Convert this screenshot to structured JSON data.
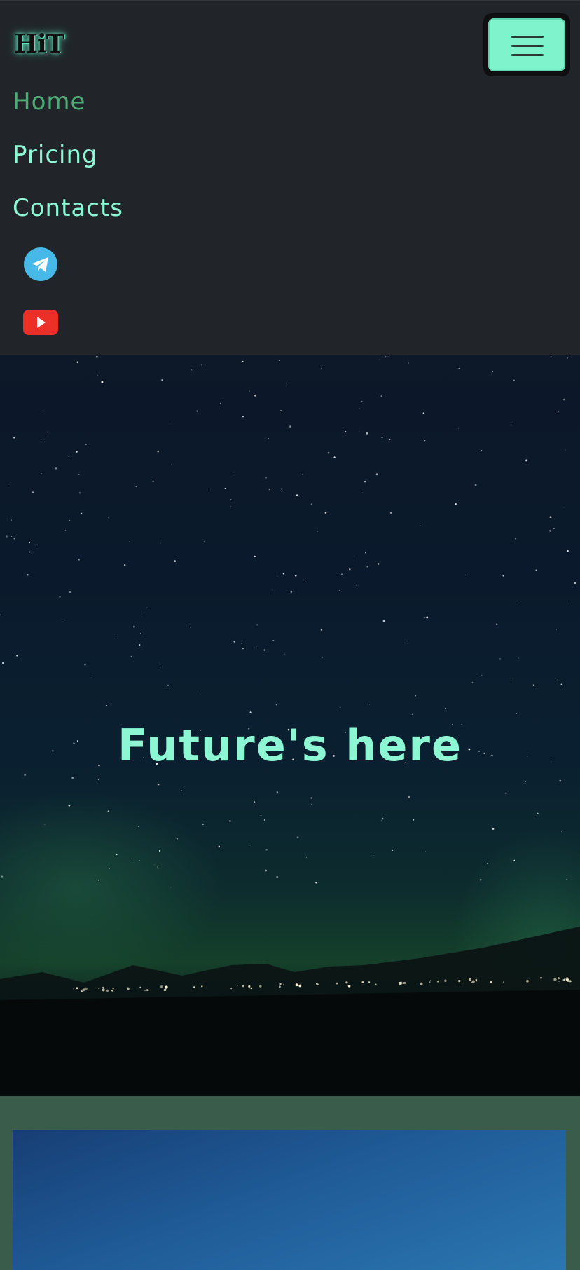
{
  "brand": {
    "logo_text": "HiT"
  },
  "nav": {
    "toggler_label": "Toggle navigation",
    "links": [
      {
        "label": "Home",
        "active": true
      },
      {
        "label": "Pricing",
        "active": false
      },
      {
        "label": "Contacts",
        "active": false
      }
    ],
    "social": [
      {
        "icon": "telegram-icon",
        "color": "#46b9e8"
      },
      {
        "icon": "youtube-icon",
        "color": "#ec3027"
      }
    ]
  },
  "hero": {
    "title": "Future's here",
    "background": "northern-lights-night-sky"
  },
  "colors": {
    "accent": "#8df7d4",
    "active_link": "#4cae76",
    "navbar_bg": "#212529",
    "section_bg": "#3a5d4b"
  }
}
